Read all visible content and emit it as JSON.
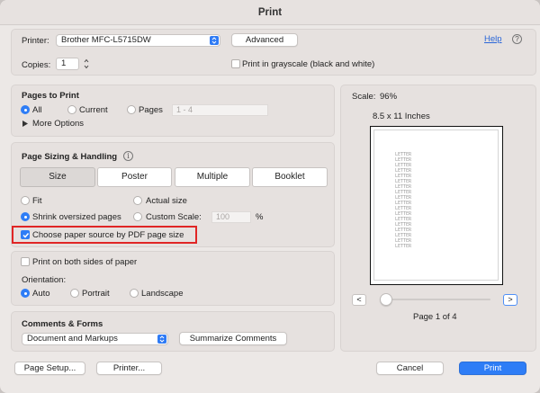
{
  "window": {
    "title": "Print"
  },
  "printer": {
    "label": "Printer:",
    "selected": "Brother MFC-L5715DW",
    "advanced_label": "Advanced",
    "help_label": "Help",
    "copies_label": "Copies:",
    "copies_value": "1",
    "grayscale_label": "Print in grayscale (black and white)",
    "grayscale_checked": false
  },
  "pages_to_print": {
    "heading": "Pages to Print",
    "all_label": "All",
    "current_label": "Current",
    "pages_label": "Pages",
    "pages_placeholder": "1 - 4",
    "selected": "All",
    "more_options_label": "More Options"
  },
  "sizing": {
    "heading": "Page Sizing & Handling",
    "tabs": [
      "Size",
      "Poster",
      "Multiple",
      "Booklet"
    ],
    "selected_tab": "Size",
    "fit_label": "Fit",
    "actual_size_label": "Actual size",
    "shrink_label": "Shrink oversized pages",
    "custom_scale_label": "Custom Scale:",
    "custom_scale_value": "100",
    "percent_label": "%",
    "selected_option": "Shrink oversized pages",
    "paper_source_label": "Choose paper source by PDF page size",
    "paper_source_checked": true
  },
  "duplex": {
    "both_sides_label": "Print on both sides of paper",
    "both_sides_checked": false,
    "orientation_label": "Orientation:",
    "auto_label": "Auto",
    "portrait_label": "Portrait",
    "landscape_label": "Landscape",
    "selected_orientation": "Auto"
  },
  "comments": {
    "heading": "Comments & Forms",
    "selected": "Document and Markups",
    "summarize_label": "Summarize Comments"
  },
  "preview": {
    "scale_label": "Scale:",
    "scale_value": "96%",
    "paper_size": "8.5 x 11 Inches",
    "letter_lines": [
      "LETTER",
      "LETTER",
      "LETTER",
      "LETTER",
      "LETTER",
      "LETTER",
      "LETTER",
      "LETTER",
      "LETTER",
      "LETTER",
      "LETTER",
      "LETTER",
      "LETTER",
      "LETTER",
      "LETTER",
      "LETTER",
      "LETTER",
      "LETTER"
    ],
    "prev_label": "<",
    "next_label": ">",
    "page_indicator": "Page 1 of 4",
    "page_position_fraction": 0.0
  },
  "footer": {
    "page_setup_label": "Page Setup...",
    "printer_button_label": "Printer...",
    "cancel_label": "Cancel",
    "print_label": "Print"
  },
  "colors": {
    "accent": "#2e7df6",
    "highlight_red": "#e02525",
    "link": "#2a66d8"
  },
  "icons": {
    "help": "question-circle-icon",
    "info": "info-circle-icon",
    "disclosure": "triangle-right-icon",
    "popup": "chevron-updown-icon",
    "checkmark": "checkmark-icon"
  }
}
